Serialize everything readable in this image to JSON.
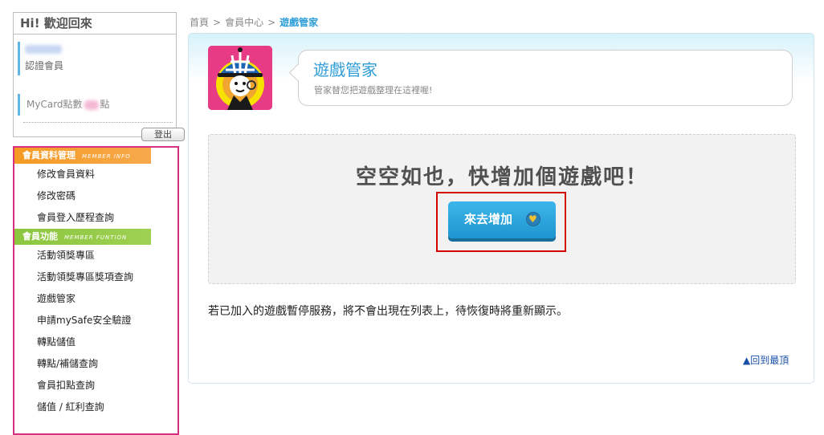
{
  "greeting": {
    "title": "Hi! 歡迎回來",
    "member_level": "認證會員",
    "points_prefix": "MyCard點數",
    "points_suffix": "點",
    "logout_label": "登出"
  },
  "menu": {
    "sections": [
      {
        "title": "會員資料管理",
        "title_en": "MEMBER INFO",
        "color": "#f59a23",
        "items": [
          "修改會員資料",
          "修改密碼",
          "會員登入歷程查詢"
        ]
      },
      {
        "title": "會員功能",
        "title_en": "MEMBER FUNTION",
        "color": "#8cc63e",
        "items": [
          "活動領獎專區",
          "活動領獎專區獎項查詢",
          "遊戲管家",
          "申請mySafe安全驗證",
          "轉點儲值",
          "轉點/補儲查詢",
          "會員扣點查詢",
          "儲值 / 紅利查詢"
        ]
      }
    ]
  },
  "breadcrumb": {
    "items": [
      "首頁",
      "會員中心",
      "遊戲管家"
    ],
    "separator": ">"
  },
  "header": {
    "title": "遊戲管家",
    "subtitle": "管家替您把遊戲整理在這裡喔!"
  },
  "empty_state": {
    "message": "空空如也，快增加個遊戲吧！",
    "add_button_label": "來去增加"
  },
  "notice": "若已加入的遊戲暫停服務，將不會出現在列表上，待恢復時將重新顯示。",
  "back_to_top": "▲回到最頂",
  "colors": {
    "accent_blue": "#2f9ed8",
    "menu_border": "#d42f80",
    "highlight_red": "#d40000"
  }
}
